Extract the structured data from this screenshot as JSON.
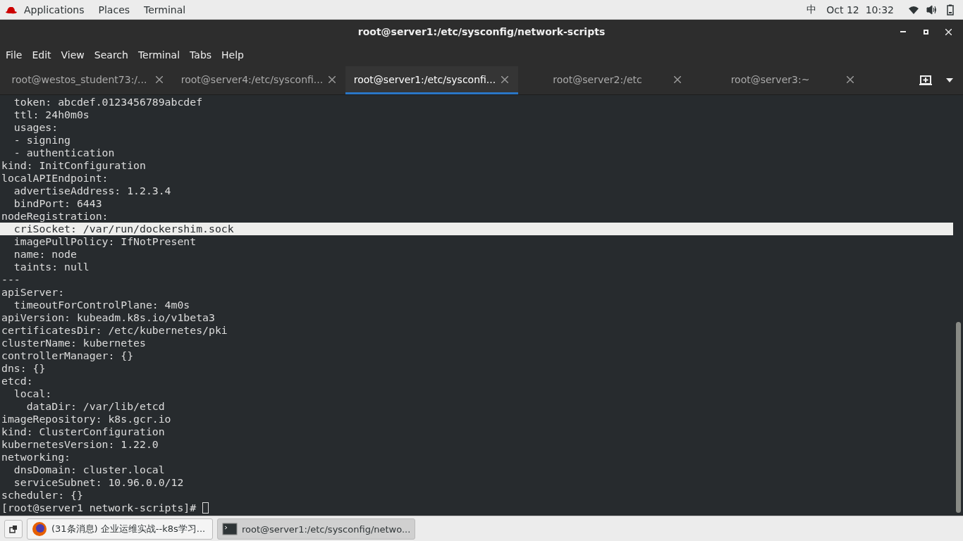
{
  "top_bar": {
    "menus": [
      "Applications",
      "Places",
      "Terminal"
    ],
    "input_method": "中",
    "clock": "Oct 12  10:32"
  },
  "window": {
    "title": "root@server1:/etc/sysconfig/network-scripts"
  },
  "menu_bar": [
    "File",
    "Edit",
    "View",
    "Search",
    "Terminal",
    "Tabs",
    "Help"
  ],
  "tabs": [
    {
      "label": "root@westos_student73:/...",
      "selected": false
    },
    {
      "label": "root@server4:/etc/sysconfi...",
      "selected": false
    },
    {
      "label": "root@server1:/etc/sysconfi...",
      "selected": true
    },
    {
      "label": "root@server2:/etc",
      "selected": false
    },
    {
      "label": "root@server3:~",
      "selected": false
    }
  ],
  "terminal": {
    "lines": [
      {
        "text": "  token: abcdef.0123456789abcdef",
        "highlighted": false
      },
      {
        "text": "  ttl: 24h0m0s",
        "highlighted": false
      },
      {
        "text": "  usages:",
        "highlighted": false
      },
      {
        "text": "  - signing",
        "highlighted": false
      },
      {
        "text": "  - authentication",
        "highlighted": false
      },
      {
        "text": "kind: InitConfiguration",
        "highlighted": false
      },
      {
        "text": "localAPIEndpoint:",
        "highlighted": false
      },
      {
        "text": "  advertiseAddress: 1.2.3.4",
        "highlighted": false
      },
      {
        "text": "  bindPort: 6443",
        "highlighted": false
      },
      {
        "text": "nodeRegistration:",
        "highlighted": false
      },
      {
        "text": "  criSocket: /var/run/dockershim.sock",
        "highlighted": true
      },
      {
        "text": "  imagePullPolicy: IfNotPresent",
        "highlighted": false
      },
      {
        "text": "  name: node",
        "highlighted": false
      },
      {
        "text": "  taints: null",
        "highlighted": false
      },
      {
        "text": "---",
        "highlighted": false
      },
      {
        "text": "apiServer:",
        "highlighted": false
      },
      {
        "text": "  timeoutForControlPlane: 4m0s",
        "highlighted": false
      },
      {
        "text": "apiVersion: kubeadm.k8s.io/v1beta3",
        "highlighted": false
      },
      {
        "text": "certificatesDir: /etc/kubernetes/pki",
        "highlighted": false
      },
      {
        "text": "clusterName: kubernetes",
        "highlighted": false
      },
      {
        "text": "controllerManager: {}",
        "highlighted": false
      },
      {
        "text": "dns: {}",
        "highlighted": false
      },
      {
        "text": "etcd:",
        "highlighted": false
      },
      {
        "text": "  local:",
        "highlighted": false
      },
      {
        "text": "    dataDir: /var/lib/etcd",
        "highlighted": false
      },
      {
        "text": "imageRepository: k8s.gcr.io",
        "highlighted": false
      },
      {
        "text": "kind: ClusterConfiguration",
        "highlighted": false
      },
      {
        "text": "kubernetesVersion: 1.22.0",
        "highlighted": false
      },
      {
        "text": "networking:",
        "highlighted": false
      },
      {
        "text": "  dnsDomain: cluster.local",
        "highlighted": false
      },
      {
        "text": "  serviceSubnet: 10.96.0.0/12",
        "highlighted": false
      },
      {
        "text": "scheduler: {}",
        "highlighted": false
      }
    ],
    "prompt": "[root@server1 network-scripts]# "
  },
  "taskbar": [
    {
      "kind": "browser",
      "label": "(31条消息) 企业运维实战--k8s学习...",
      "selected": false
    },
    {
      "kind": "terminal",
      "label": "root@server1:/etc/sysconfig/netwo...",
      "selected": true
    }
  ]
}
